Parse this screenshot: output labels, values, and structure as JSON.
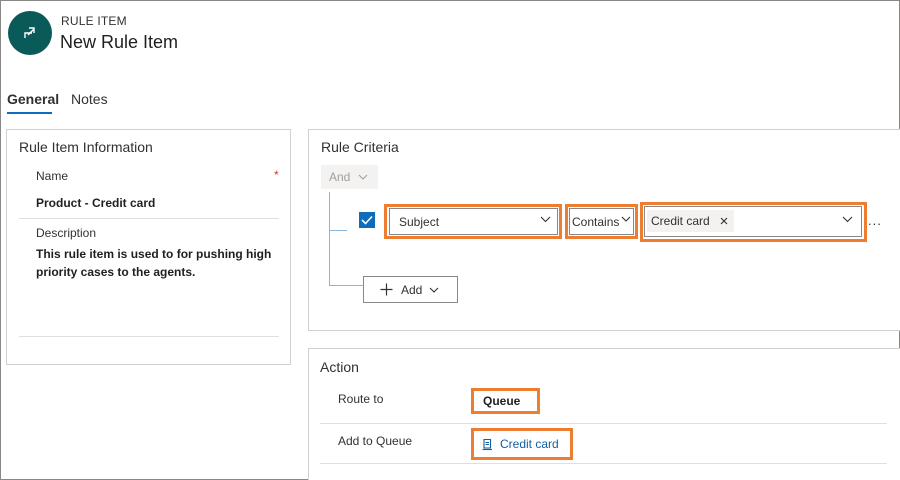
{
  "header": {
    "entity_type": "RULE ITEM",
    "title": "New Rule Item",
    "avatar_icon": "route-arrow-icon",
    "avatar_color": "#0b5a5a"
  },
  "tabs": [
    {
      "label": "General",
      "selected": true
    },
    {
      "label": "Notes",
      "selected": false
    }
  ],
  "rule_item_information": {
    "title": "Rule Item Information",
    "name_label": "Name",
    "name_value": "Product - Credit card",
    "name_required": "*",
    "description_label": "Description",
    "description_line1": "This rule item is used to for pushing high",
    "description_line2": "priority cases to the agents."
  },
  "rule_criteria": {
    "title": "Rule Criteria",
    "group_operator": "And",
    "condition": {
      "checked": true,
      "field": "Subject",
      "operator": "Contains",
      "value_tag": "Credit card"
    },
    "more_label": "...",
    "add_label": "Add"
  },
  "action": {
    "title": "Action",
    "route_to_label": "Route to",
    "route_to_value": "Queue",
    "add_to_queue_label": "Add to Queue",
    "add_to_queue_value": "Credit card"
  },
  "colors": {
    "accent": "#0f6cbd",
    "highlight": "#ed7d31",
    "link": "#115ea3",
    "required": "#d13438"
  }
}
